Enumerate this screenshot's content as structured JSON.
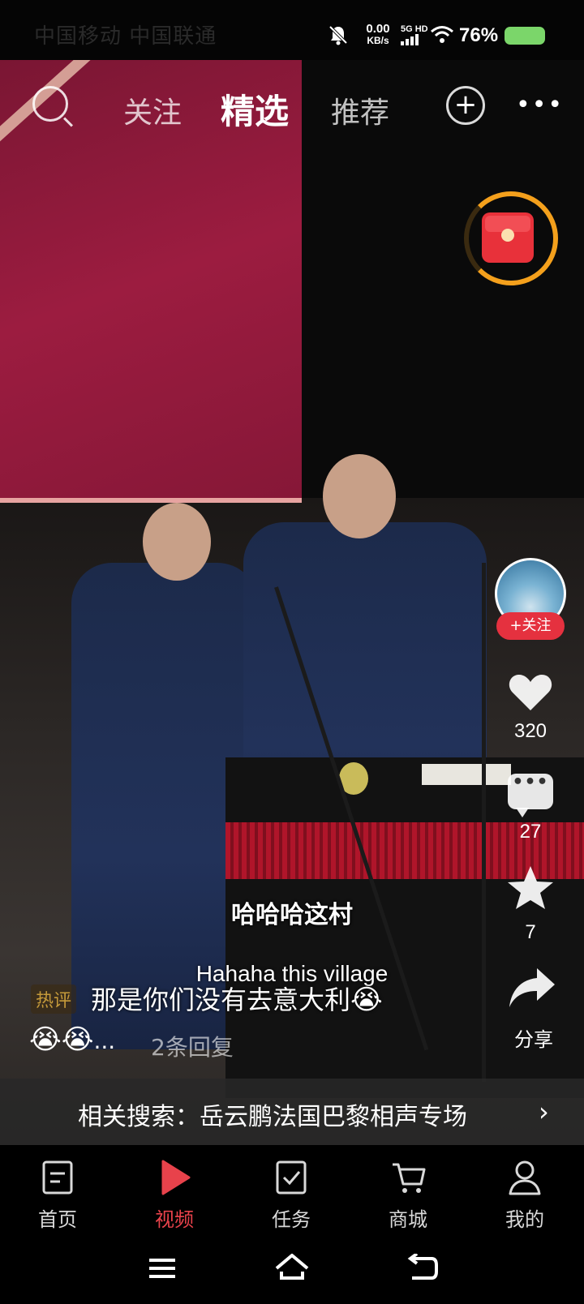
{
  "status_bar": {
    "carrier": "中国移动 中国联通",
    "net_speed_value": "0.00",
    "net_speed_unit": "KB/s",
    "network": "5G HD",
    "battery": "76%"
  },
  "top_nav": {
    "tabs": [
      {
        "label": "关注"
      },
      {
        "label": "精选"
      },
      {
        "label": "推荐"
      }
    ]
  },
  "subtitles": {
    "cn": "哈哈哈这村",
    "en": "Hahaha this village"
  },
  "actions": {
    "follow_label": "+关注",
    "likes": "320",
    "comments": "27",
    "favorites": "7",
    "share_label": "分享"
  },
  "hot_comment": {
    "badge": "热评",
    "text": "那是你们没有去意大利",
    "emoji": "😭",
    "ellipsis": "...",
    "replies": "2条回复"
  },
  "related_search": {
    "text": "相关搜索：岳云鹏法国巴黎相声专场",
    "arrow": "›"
  },
  "bottom_nav": {
    "items": [
      {
        "label": "首页",
        "icon": "home-doc-icon"
      },
      {
        "label": "视频",
        "icon": "play-icon"
      },
      {
        "label": "任务",
        "icon": "task-check-icon"
      },
      {
        "label": "商城",
        "icon": "cart-icon"
      },
      {
        "label": "我的",
        "icon": "person-icon"
      }
    ],
    "active_index": 1
  },
  "colors": {
    "accent_red": "#e8424b",
    "follow_red": "#e5313f",
    "redpacket_ring": "#f4a01c",
    "battery_green": "#7bd66a"
  }
}
